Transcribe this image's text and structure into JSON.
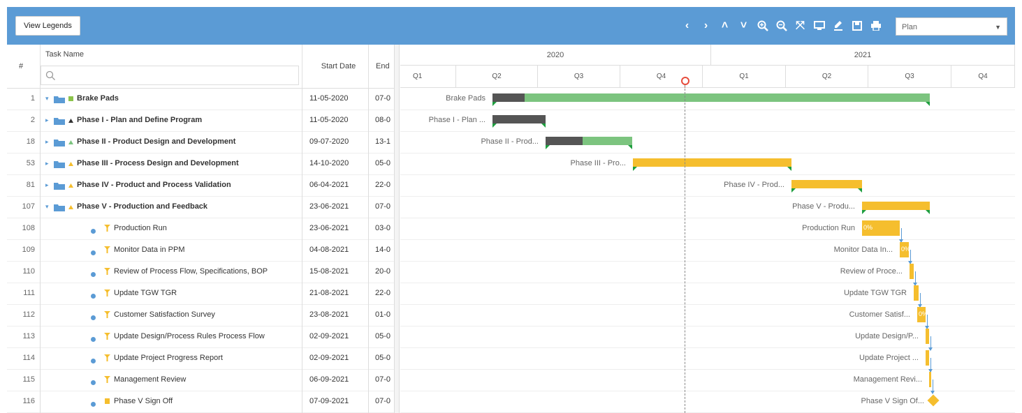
{
  "toolbar": {
    "view_legends_label": "View Legends",
    "icons": [
      "chevron-left-icon",
      "chevron-right-icon",
      "expand-up-icon",
      "collapse-down-icon",
      "zoom-in-icon",
      "zoom-out-icon",
      "fit-screen-icon",
      "monitor-icon",
      "highlight-icon",
      "save-icon",
      "print-icon"
    ],
    "view_select": {
      "value": "Plan",
      "options": [
        "Plan"
      ]
    }
  },
  "grid": {
    "columns": {
      "num": "#",
      "task_name": "Task Name",
      "start_date": "Start Date",
      "end": "End"
    },
    "rows": [
      {
        "id": "1",
        "name": "Brake Pads",
        "start": "11-05-2020",
        "end": "07-0",
        "bold": true,
        "kind": "project",
        "expand": "open"
      },
      {
        "id": "2",
        "name": "Phase I - Plan and Define Program",
        "start": "11-05-2020",
        "end": "08-0",
        "bold": true,
        "kind": "phase",
        "expand": "closed",
        "color": "#333333"
      },
      {
        "id": "18",
        "name": "Phase II - Product Design and Development",
        "start": "09-07-2020",
        "end": "13-1",
        "bold": true,
        "kind": "phase",
        "expand": "closed",
        "color": "#7cc47f"
      },
      {
        "id": "53",
        "name": "Phase III - Process Design and Development",
        "start": "14-10-2020",
        "end": "05-0",
        "bold": true,
        "kind": "phase",
        "expand": "closed",
        "color": "#f5be2e"
      },
      {
        "id": "81",
        "name": "Phase IV - Product and Process Validation",
        "start": "06-04-2021",
        "end": "22-0",
        "bold": true,
        "kind": "phase",
        "expand": "closed",
        "color": "#f5be2e"
      },
      {
        "id": "107",
        "name": "Phase V - Production and Feedback",
        "start": "23-06-2021",
        "end": "07-0",
        "bold": true,
        "kind": "phase",
        "expand": "open",
        "color": "#f5be2e"
      },
      {
        "id": "108",
        "name": "Production Run",
        "start": "23-06-2021",
        "end": "03-0",
        "bold": false,
        "kind": "task"
      },
      {
        "id": "109",
        "name": "Monitor Data in PPM",
        "start": "04-08-2021",
        "end": "14-0",
        "bold": false,
        "kind": "task"
      },
      {
        "id": "110",
        "name": "Review of Process Flow, Specifications, BOP",
        "start": "15-08-2021",
        "end": "20-0",
        "bold": false,
        "kind": "task"
      },
      {
        "id": "111",
        "name": "Update TGW TGR",
        "start": "21-08-2021",
        "end": "22-0",
        "bold": false,
        "kind": "task"
      },
      {
        "id": "112",
        "name": "Customer Satisfaction Survey",
        "start": "23-08-2021",
        "end": "01-0",
        "bold": false,
        "kind": "task"
      },
      {
        "id": "113",
        "name": "Update Design/Process Rules Process Flow",
        "start": "02-09-2021",
        "end": "05-0",
        "bold": false,
        "kind": "task"
      },
      {
        "id": "114",
        "name": "Update Project Progress Report",
        "start": "02-09-2021",
        "end": "05-0",
        "bold": false,
        "kind": "task"
      },
      {
        "id": "115",
        "name": "Management Review",
        "start": "06-09-2021",
        "end": "07-0",
        "bold": false,
        "kind": "task"
      },
      {
        "id": "116",
        "name": "Phase V Sign Off",
        "start": "07-09-2021",
        "end": "07-0",
        "bold": false,
        "kind": "milestone"
      }
    ]
  },
  "timeline": {
    "years": [
      "2020",
      "2021"
    ],
    "quarters": [
      "Q1",
      "Q2",
      "Q3",
      "Q4",
      "Q1",
      "Q2",
      "Q3",
      "Q4"
    ],
    "bars": [
      {
        "label": "Brake Pads",
        "type": "summary",
        "color": "#7cc47f",
        "progress_color": "#555555"
      },
      {
        "label": "Phase I - Plan ...",
        "type": "summary",
        "color": "#555555",
        "progress_color": "#555555"
      },
      {
        "label": "Phase II - Prod...",
        "type": "summary",
        "color": "#7cc47f",
        "progress_color": "#555555"
      },
      {
        "label": "Phase III - Pro...",
        "type": "summary",
        "color": "#f5be2e"
      },
      {
        "label": "Phase IV - Prod...",
        "type": "summary",
        "color": "#f5be2e"
      },
      {
        "label": "Phase V - Produ...",
        "type": "summary",
        "color": "#f5be2e"
      },
      {
        "label": "Production Run",
        "type": "task",
        "color": "#f5be2e",
        "pct": "0%"
      },
      {
        "label": "Monitor Data In...",
        "type": "task",
        "color": "#f5be2e",
        "pct": "0%"
      },
      {
        "label": "Review of Proce...",
        "type": "task",
        "color": "#f5be2e"
      },
      {
        "label": "Update TGW TGR",
        "type": "task",
        "color": "#f5be2e"
      },
      {
        "label": "Customer Satisf...",
        "type": "task",
        "color": "#f5be2e",
        "pct": "0%"
      },
      {
        "label": "Update Design/P...",
        "type": "task",
        "color": "#f5be2e"
      },
      {
        "label": "Update Project ...",
        "type": "task",
        "color": "#f5be2e"
      },
      {
        "label": "Management Revi...",
        "type": "task",
        "color": "#f5be2e"
      },
      {
        "label": "Phase V Sign Of...",
        "type": "milestone",
        "color": "#f5be2e"
      }
    ]
  },
  "colors": {
    "toolbar": "#5b9bd5",
    "folder": "#5b9bd5",
    "task_dot": "#5b9bd5",
    "today_marker": "#e74c3c",
    "connector": "#5b9bd5"
  }
}
